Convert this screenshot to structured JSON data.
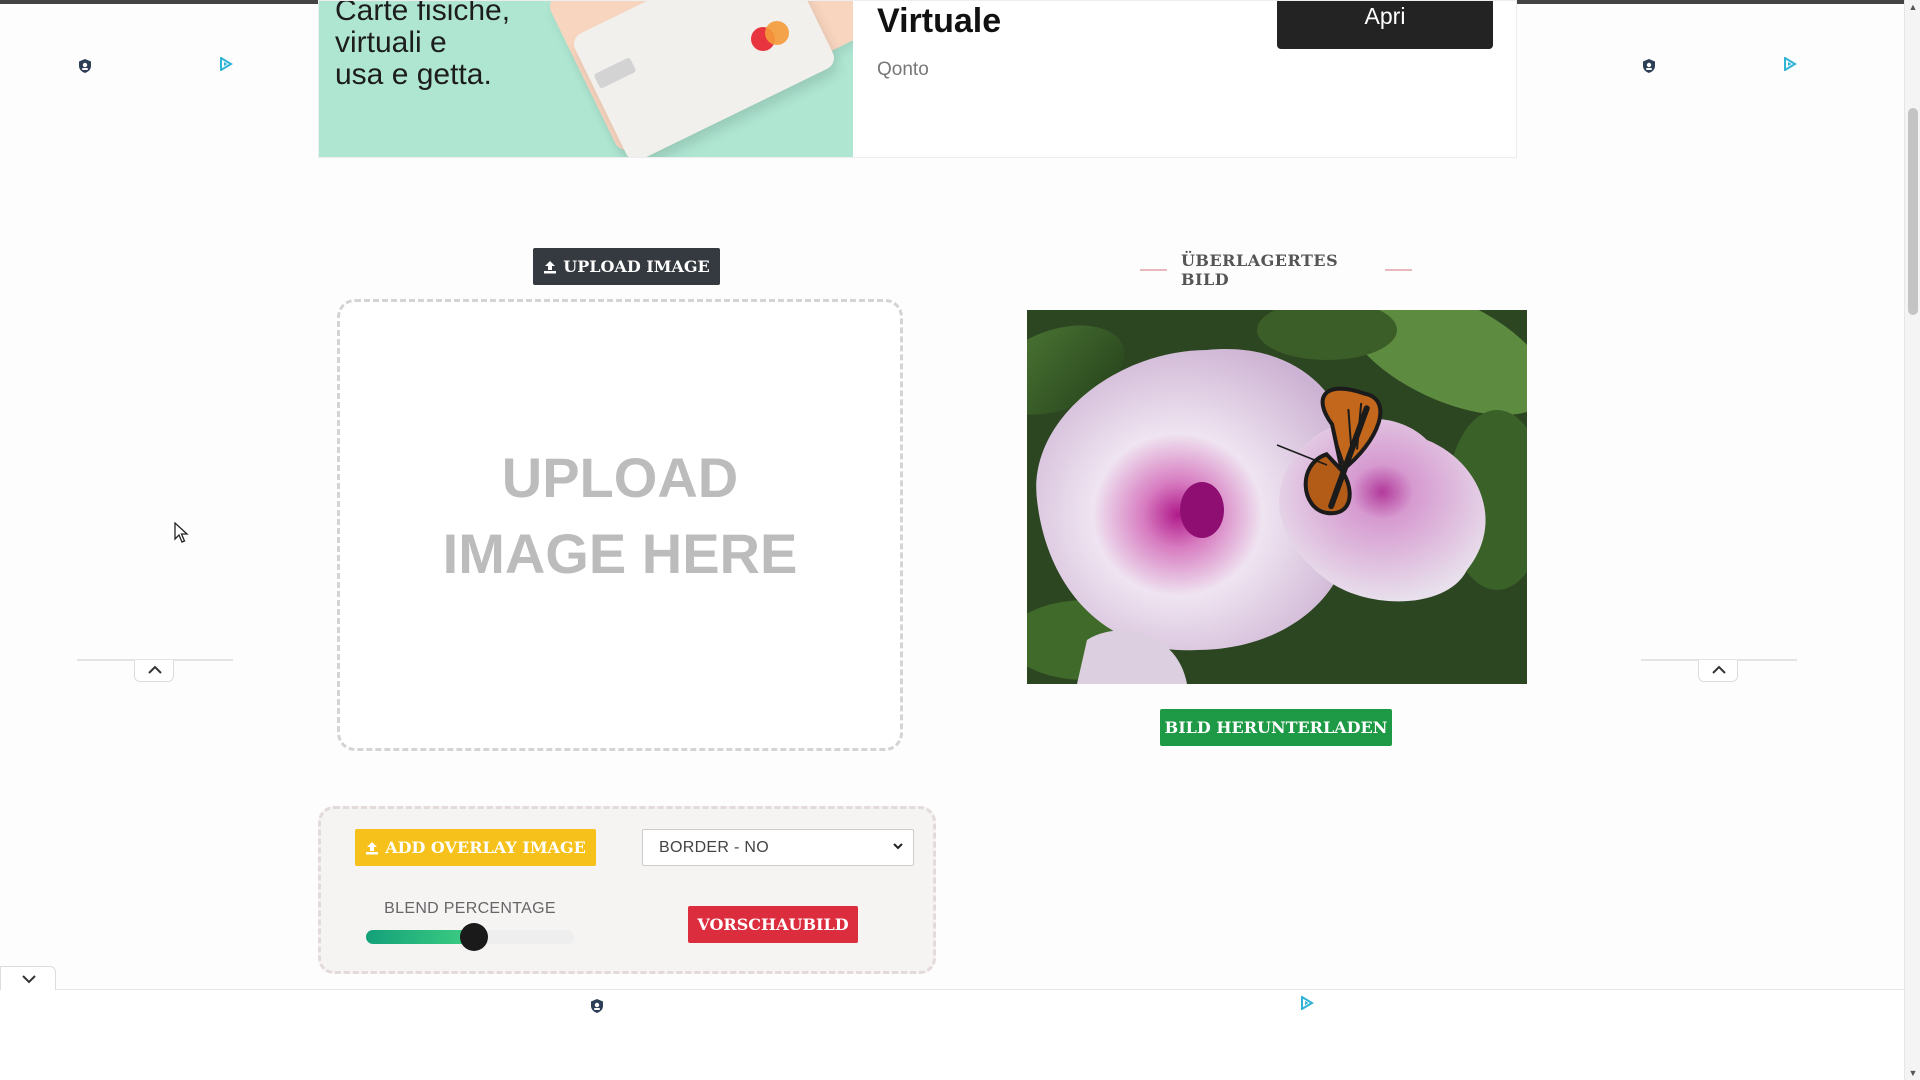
{
  "ad": {
    "image_text": "Carte fisiche,\nvirtuali e\nusa e getta.",
    "title": "Virtuale",
    "brand": "Qonto",
    "cta": "Apri"
  },
  "upload": {
    "button_label": "UPLOAD IMAGE",
    "dropzone_text": "UPLOAD\nIMAGE HERE"
  },
  "result": {
    "heading": "ÜBERLAGERTES BILD",
    "download_label": "BILD HERUNTERLADEN"
  },
  "controls": {
    "overlay_label": "ADD OVERLAY IMAGE",
    "border_select": "BORDER - NO",
    "blend_label": "BLEND PERCENTAGE",
    "blend_value": 0.52,
    "preview_label": "VORSCHAUBILD"
  },
  "colors": {
    "dark": "#343a40",
    "green": "#1e9a46",
    "yellow": "#f6c11a",
    "red": "#dc2d3f",
    "ad_mint": "#aee6d2"
  },
  "icons": [
    "upload-icon",
    "shield-icon",
    "adchoices-icon",
    "chevron-up-icon",
    "chevron-down-icon",
    "mouse-cursor-icon"
  ]
}
